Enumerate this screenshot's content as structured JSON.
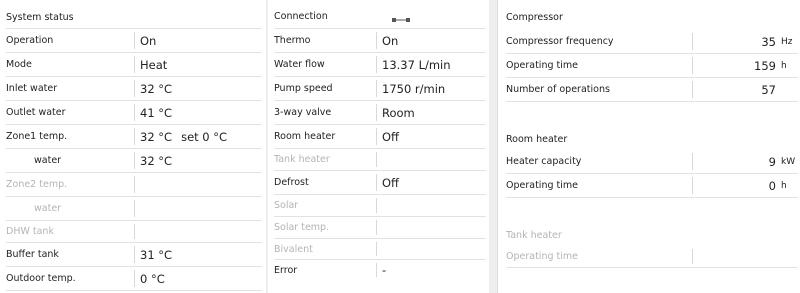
{
  "system_status": {
    "title": "System status",
    "rows": [
      {
        "label": "Operation",
        "value": "On"
      },
      {
        "label": "Mode",
        "value": "Heat"
      },
      {
        "label": "Inlet water",
        "value": "32 °C"
      },
      {
        "label": "Outlet water",
        "value": "41 °C"
      },
      {
        "label": "Zone1 temp.",
        "value": "32 °C",
        "extra": "set 0 °C"
      },
      {
        "label": "water",
        "value": "32 °C"
      },
      {
        "label": "Zone2 temp.",
        "value": ""
      },
      {
        "label": "water",
        "value": ""
      },
      {
        "label": "DHW tank",
        "value": ""
      },
      {
        "label": "Buffer tank",
        "value": "31 °C"
      },
      {
        "label": "Outdoor temp.",
        "value": "0 °C"
      }
    ]
  },
  "middle": {
    "connection_label": "Connection",
    "connection_icon": "connection-plug-icon",
    "rows": [
      {
        "label": "Thermo",
        "value": "On"
      },
      {
        "label": "Water flow",
        "value": "13.37 L/min"
      },
      {
        "label": "Pump speed",
        "value": "1750 r/min"
      },
      {
        "label": "3-way valve",
        "value": "Room"
      },
      {
        "label": "Room heater",
        "value": "Off"
      },
      {
        "label": "Tank heater",
        "value": ""
      },
      {
        "label": "Defrost",
        "value": "Off"
      },
      {
        "label": "Solar",
        "value": ""
      },
      {
        "label": "Solar temp.",
        "value": ""
      },
      {
        "label": "Bivalent",
        "value": ""
      },
      {
        "label": "Error",
        "value": "-"
      }
    ]
  },
  "compressor": {
    "title": "Compressor",
    "rows": [
      {
        "label": "Compressor frequency",
        "value": "35",
        "unit": "Hz"
      },
      {
        "label": "Operating time",
        "value": "159",
        "unit": "h"
      },
      {
        "label": "Number of operations",
        "value": "57",
        "unit": ""
      }
    ]
  },
  "room_heater": {
    "title": "Room heater",
    "rows": [
      {
        "label": "Heater capacity",
        "value": "9",
        "unit": "kW"
      },
      {
        "label": "Operating time",
        "value": "0",
        "unit": "h"
      }
    ]
  },
  "tank_heater": {
    "title": "Tank heater",
    "rows": [
      {
        "label": "Operating time",
        "value": "",
        "unit": ""
      }
    ]
  }
}
